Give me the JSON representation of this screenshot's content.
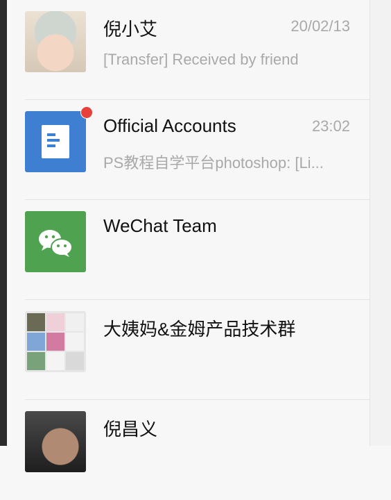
{
  "chats": [
    {
      "name": "倪小艾",
      "time": "20/02/13",
      "preview": "[Transfer] Received by friend",
      "avatar": "child-photo-avatar"
    },
    {
      "name": "Official Accounts",
      "time": "23:02",
      "preview": "PS教程自学平台photoshop: [Li...",
      "avatar": "official-accounts-icon",
      "unread": true
    },
    {
      "name": "WeChat Team",
      "time": "",
      "preview": "",
      "avatar": "wechat-logo-icon"
    },
    {
      "name": "大姨妈&金姆产品技术群",
      "time": "",
      "preview": "",
      "avatar": "group-avatar-grid"
    },
    {
      "name": "倪昌义",
      "time": "",
      "preview": "",
      "avatar": "man-photo-avatar"
    }
  ],
  "colors": {
    "official_accounts_bg": "#3f7fd1",
    "wechat_team_bg": "#4fa24f",
    "unread_dot": "#e7403a",
    "muted_text": "#a9a9a9"
  }
}
